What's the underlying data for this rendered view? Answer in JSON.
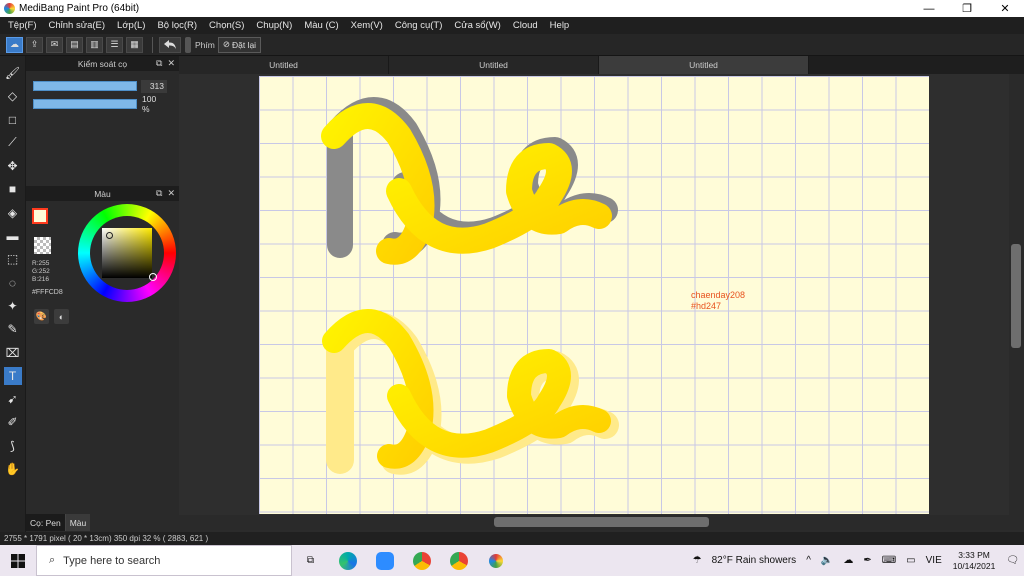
{
  "window": {
    "title": "MediBang Paint Pro (64bit)",
    "min": "—",
    "max": "❐",
    "close": "✕"
  },
  "menu": [
    "Tệp(F)",
    "Chỉnh sửa(E)",
    "Lớp(L)",
    "Bộ lọc(R)",
    "Chọn(S)",
    "Chụp(N)",
    "Màu (C)",
    "Xem(V)",
    "Công cụ(T)",
    "Cửa sổ(W)",
    "Cloud",
    "Help"
  ],
  "toolbar": {
    "key_label": "Phím",
    "reset_label": "Đặt lại"
  },
  "brush_panel": {
    "title": "Kiểm soát cọ",
    "size_value": "313",
    "opacity_value": "100 %"
  },
  "color_panel": {
    "title": "Màu",
    "rgb": "R:255\nG:252\nB:216",
    "hex": "#FFFCD8",
    "fg_color": "#FFFCD8"
  },
  "bottom_tabs": [
    "Cọ: Pen",
    "Màu"
  ],
  "doc_tabs": [
    "Untitled",
    "Untitled",
    "Untitled"
  ],
  "canvas": {
    "watermark_line1": "chaenday208",
    "watermark_line2": "#hd247",
    "paper_color": "#FFFCD8",
    "stroke_color": "#FFE000"
  },
  "status": "2755 * 1791 pixel   ( 20 * 13cm)   350 dpi   32 %   ( 2883, 621 )",
  "taskbar": {
    "search_placeholder": "Type here to search",
    "weather": "82°F  Rain showers",
    "lang": "VIE",
    "time": "3:33 PM",
    "date": "10/14/2021"
  }
}
